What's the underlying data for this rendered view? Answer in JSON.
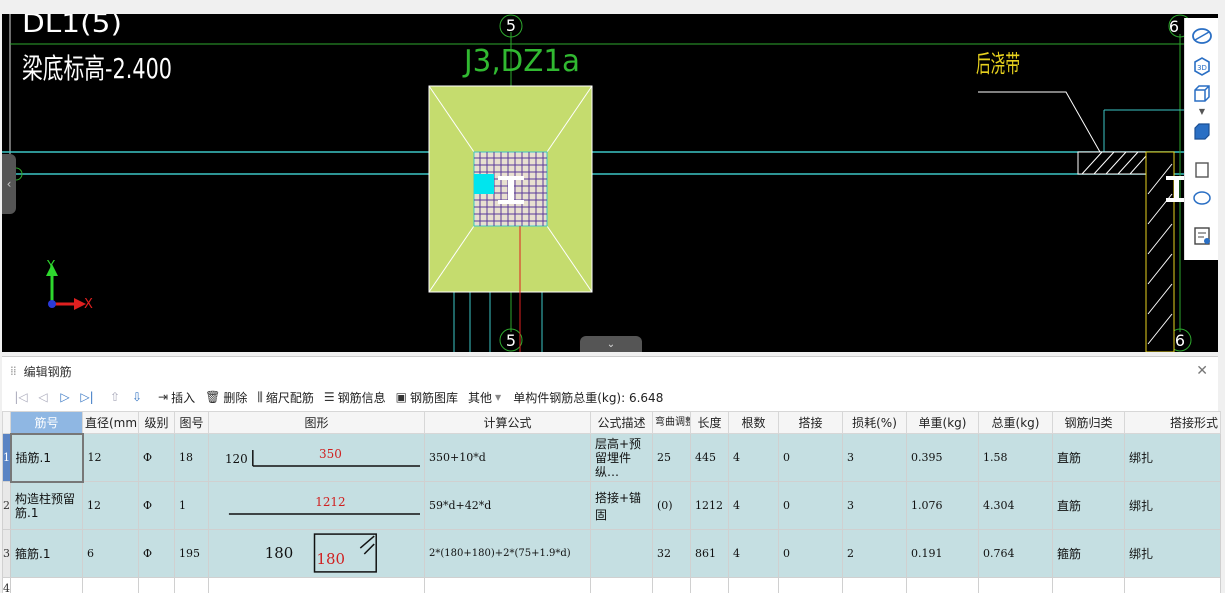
{
  "viewport": {
    "labels": {
      "top_left_partial": "DL1(5)",
      "beam_bottom": "梁底标高-2.400",
      "element_id": "J3,DZ1a",
      "post_pour": "后浇带",
      "axis_5_top": "5",
      "axis_5_bottom": "5",
      "axis_6_top": "6",
      "axis_6_bottom": "6",
      "axis_y": "Y",
      "axis_x": "X"
    },
    "colors": {
      "background": "#000000",
      "footing": "#c5dc6e",
      "grid_cyan": "#3cc6c6",
      "axis_green": "#2ea82e",
      "label_green": "#31b931",
      "post_pour_yellow": "#e8d21e"
    }
  },
  "right_toolbar": {
    "items": [
      "orbit-icon",
      "3d-view-icon",
      "box-view-icon",
      "wireframe-icon",
      "layer-icon",
      "rotate-icon",
      "report-icon"
    ],
    "label_3d": "3D"
  },
  "panel": {
    "title": "编辑钢筋",
    "toolbar": {
      "insert": "插入",
      "delete": "删除",
      "scale_rebar": "缩尺配筋",
      "rebar_info": "钢筋信息",
      "rebar_library": "钢筋图库",
      "other": "其他",
      "total_weight": "单构件钢筋总重(kg): 6.648"
    },
    "columns": [
      "筋号",
      "直径(mm)",
      "级别",
      "图号",
      "图形",
      "计算公式",
      "公式描述",
      "弯曲调整",
      "长度",
      "根数",
      "搭接",
      "损耗(%)",
      "单重(kg)",
      "总重(kg)",
      "钢筋归类",
      "搭接形式"
    ],
    "rows": [
      {
        "num": "1",
        "name": "插筋.1",
        "diameter": "12",
        "grade": "Φ",
        "fig_no": "18",
        "shape_left": "120",
        "shape_main": "350",
        "formula": "350+10*d",
        "desc": "层高+预留埋件纵…",
        "bend": "25",
        "length": "445",
        "count": "4",
        "lap": "0",
        "loss": "3",
        "unit_weight": "0.395",
        "total_weight": "1.58",
        "category": "直筋",
        "lap_type": "绑扎"
      },
      {
        "num": "2",
        "name": "构造柱预留筋.1",
        "diameter": "12",
        "grade": "Φ",
        "fig_no": "1",
        "shape_main": "1212",
        "formula": "59*d+42*d",
        "desc": "搭接+锚固",
        "bend": "(0)",
        "length": "1212",
        "count": "4",
        "lap": "0",
        "loss": "3",
        "unit_weight": "1.076",
        "total_weight": "4.304",
        "category": "直筋",
        "lap_type": "绑扎"
      },
      {
        "num": "3",
        "name": "箍筋.1",
        "diameter": "6",
        "grade": "Φ",
        "fig_no": "195",
        "shape_left": "180",
        "shape_main": "180",
        "formula": "2*(180+180)+2*(75+1.9*d)",
        "desc": "",
        "bend": "32",
        "length": "861",
        "count": "4",
        "lap": "0",
        "loss": "2",
        "unit_weight": "0.191",
        "total_weight": "0.764",
        "category": "箍筋",
        "lap_type": "绑扎"
      }
    ],
    "empty_row_num": "4"
  }
}
